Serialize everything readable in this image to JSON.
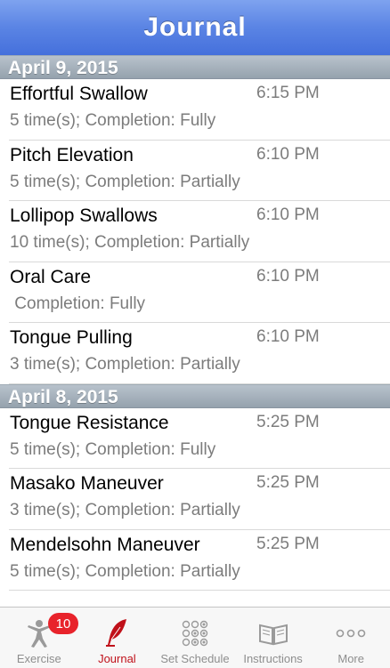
{
  "nav": {
    "title": "Journal"
  },
  "sections": [
    {
      "date": "April 9, 2015",
      "entries": [
        {
          "name": "Effortful Swallow",
          "time": "6:15 PM",
          "detail": "5 time(s); Completion: Fully"
        },
        {
          "name": "Pitch Elevation",
          "time": "6:10 PM",
          "detail": "5 time(s); Completion: Partially"
        },
        {
          "name": "Lollipop Swallows",
          "time": "6:10 PM",
          "detail": "10 time(s); Completion: Partially"
        },
        {
          "name": "Oral Care",
          "time": "6:10 PM",
          "detail": " Completion: Fully"
        },
        {
          "name": "Tongue Pulling",
          "time": "6:10 PM",
          "detail": "3 time(s); Completion: Partially"
        }
      ]
    },
    {
      "date": "April 8, 2015",
      "entries": [
        {
          "name": "Tongue Resistance",
          "time": "5:25 PM",
          "detail": "5 time(s); Completion: Fully"
        },
        {
          "name": "Masako Maneuver",
          "time": "5:25 PM",
          "detail": "3 time(s); Completion: Partially"
        },
        {
          "name": "Mendelsohn Maneuver",
          "time": "5:25 PM",
          "detail": "5 time(s); Completion: Partially"
        }
      ]
    }
  ],
  "tabbar": {
    "exercise": {
      "label": "Exercise",
      "badge": "10",
      "icon": "person-icon"
    },
    "journal": {
      "label": "Journal",
      "icon": "quill-icon",
      "active": true
    },
    "schedule": {
      "label": "Set Schedule",
      "icon": "dots-grid-icon"
    },
    "instructions": {
      "label": "Instructions",
      "icon": "book-icon"
    },
    "more": {
      "label": "More",
      "icon": "more-icon"
    }
  },
  "colors": {
    "nav": "#5a84e4",
    "active_tab": "#c0111a",
    "badge": "#e8232b",
    "secondary_text": "#7c7c7c"
  }
}
